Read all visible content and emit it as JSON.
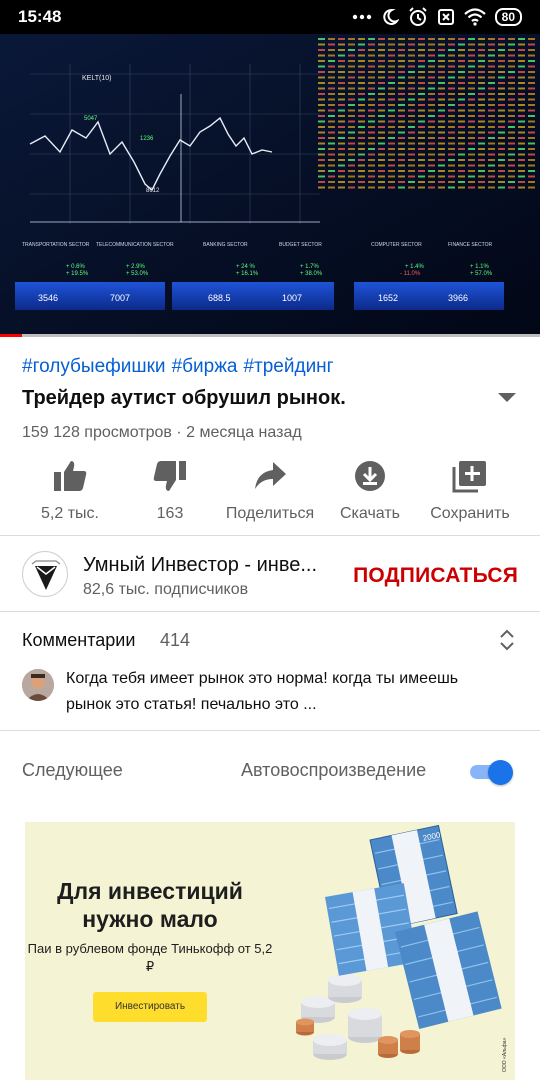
{
  "status_bar": {
    "time": "15:48",
    "battery": "80",
    "icons": [
      "dots-icon",
      "moon-icon",
      "alarm-icon",
      "no-sim-icon",
      "wifi-icon",
      "battery-icon"
    ]
  },
  "video": {
    "progress_fraction": 0.04,
    "overlay_texts": {
      "kelt": "KELT(10)",
      "sectors": [
        "TRANSPORTATION SECTOR",
        "TELECOMMUNICATION SECTOR",
        "BANKING SECTOR",
        "BUDGET SECTOR",
        "COMPUTER SECTOR",
        "FINANCE SECTOR"
      ],
      "values": [
        "3546",
        "7007",
        "688.5",
        "1007",
        "1652",
        "3966"
      ]
    }
  },
  "info": {
    "hashtags": [
      "#голубыефишки",
      "#биржа",
      "#трейдинг"
    ],
    "title": "Трейдер аутист обрушил рынок.",
    "meta": "159 128 просмотров · 2 месяца назад"
  },
  "actions": {
    "like": "5,2 тыс.",
    "dislike": "163",
    "share": "Поделиться",
    "download": "Скачать",
    "save": "Сохранить"
  },
  "channel": {
    "name": "Умный Инвестор - инве...",
    "subscribers": "82,6 тыс. подписчиков",
    "subscribe": "ПОДПИСАТЬСЯ"
  },
  "comments": {
    "label": "Комментарии",
    "count": "414",
    "top_comment": "Когда тебя имеет рынок это норма! когда ты имеешь рынок это статья! печально это ..."
  },
  "up_next": {
    "label": "Следующее",
    "autoplay_label": "Автовоспроизведение",
    "autoplay_on": true
  },
  "ad": {
    "headline": "Для инвестиций нужно мало",
    "subtext": "Паи в рублевом фонде Тинькофф от 5,2 ₽",
    "button": "Инвестировать",
    "banknote_label": "2000",
    "background_color": "#f4f3d4",
    "button_color": "#ffdd2d"
  },
  "colors": {
    "link": "#065fd4",
    "subscribe": "#cc0000",
    "toggle": "#1a73e8",
    "progress": "#ff0000"
  }
}
